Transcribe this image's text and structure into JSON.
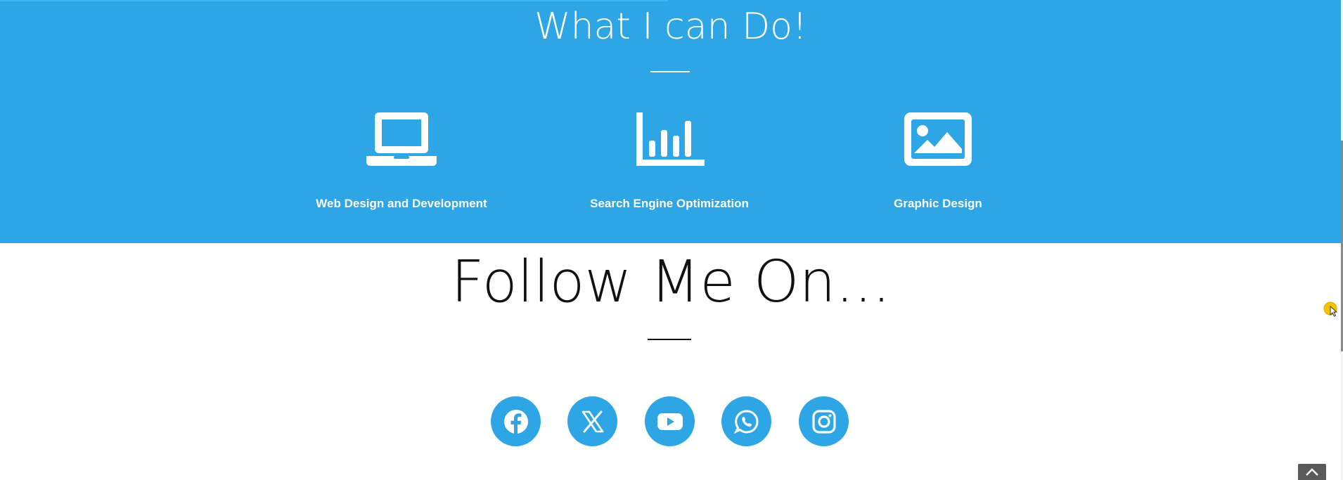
{
  "services": {
    "title": "What I can Do!",
    "items": [
      {
        "label": "Web Design and Development",
        "icon": "laptop-icon"
      },
      {
        "label": "Search Engine Optimization",
        "icon": "bar-chart-icon"
      },
      {
        "label": "Graphic Design",
        "icon": "image-icon"
      }
    ],
    "background_color": "#2ea5e5"
  },
  "follow": {
    "title": "Follow Me On...",
    "socials": [
      {
        "name": "facebook",
        "icon": "facebook-icon"
      },
      {
        "name": "x",
        "icon": "x-twitter-icon"
      },
      {
        "name": "youtube",
        "icon": "youtube-icon"
      },
      {
        "name": "whatsapp",
        "icon": "whatsapp-icon"
      },
      {
        "name": "instagram",
        "icon": "instagram-icon"
      }
    ],
    "accent_color": "#2ea5e5"
  },
  "back_to_top": {
    "icon": "chevron-up-icon"
  }
}
